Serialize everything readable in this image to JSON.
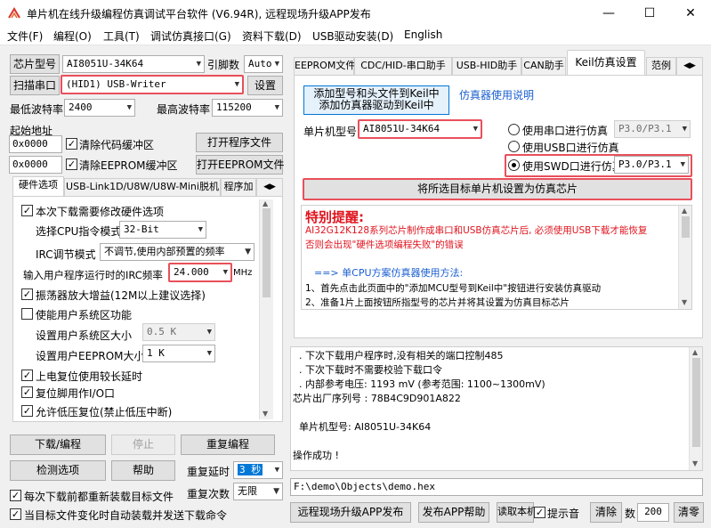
{
  "window": {
    "title": "单片机在线升级编程仿真调试平台软件 (V6.94R), 远程现场升级APP发布",
    "minimize": "—",
    "maximize": "☐",
    "close": "✕"
  },
  "menu": [
    "文件(F)",
    "编程(O)",
    "工具(T)",
    "调试仿真接口(G)",
    "资料下载(D)",
    "USB驱动安装(D)",
    "English"
  ],
  "left": {
    "chip_label": "芯片型号",
    "chip_value": "AI8051U-34K64",
    "pin_label": "引脚数",
    "pin_value": "Auto",
    "scan_button": "扫描串口",
    "port_value": "(HID1) USB-Writer",
    "settings_button": "设置",
    "min_baud_label": "最低波特率",
    "min_baud_value": "2400",
    "max_baud_label": "最高波特率",
    "max_baud_value": "115200",
    "start_addr_label": "起始地址",
    "addr1_value": "0x0000",
    "clear_code_label": "清除代码缓冲区",
    "open_prog_button": "打开程序文件",
    "addr2_value": "0x0000",
    "clear_eeprom_label": "清除EEPROM缓冲区",
    "open_eeprom_button": "打开EEPROM文件",
    "tabs": [
      "硬件选项",
      "USB-Link1D/U8W/U8W-Mini脱机",
      "程序加"
    ],
    "hw": {
      "need_modify": "本次下载需要修改硬件选项",
      "cpu_mode_label": "选择CPU指令模式",
      "cpu_mode_value": "32-Bit",
      "irc_mode_label": "IRC调节模式",
      "irc_mode_value": "不调节,使用内部预置的频率",
      "irc_freq_label": "输入用户程序运行时的IRC频率",
      "irc_freq_value": "24.000",
      "irc_unit": "MHz",
      "osc_gain": "振荡器放大增益(12M以上建议选择)",
      "enable_user_sys": "使能用户系统区功能",
      "user_sys_size_label": "设置用户系统区大小",
      "user_sys_size_value": "0.5 K",
      "eeprom_size_label": "设置用户EEPROM大小",
      "eeprom_size_value": "1   K",
      "power_delay": "上电复位使用较长延时",
      "reset_pin_io": "复位脚用作I/O口",
      "low_volt_reset": "允许低压复位(禁止低压中断)"
    },
    "download_button": "下载/编程",
    "stop_button": "停止",
    "reprogram_button": "重复编程",
    "check_button": "检测选项",
    "help_button": "帮助",
    "repeat_delay_label": "重复延时",
    "repeat_delay_value": "3 秒",
    "repeat_count_label": "重复次数",
    "repeat_count_value": "无限",
    "reload_label": "每次下载前都重新装载目标文件",
    "auto_load_label": "当目标文件变化时自动装载并发送下载命令"
  },
  "right": {
    "tabs": [
      "EEPROM文件",
      "CDC/HID-串口助手",
      "USB-HID助手",
      "CAN助手",
      "Keil仿真设置",
      "范例"
    ],
    "keil_button_line1": "添加型号和头文件到Keil中",
    "keil_button_line2": "添加仿真器驱动到Keil中",
    "emu_doc_link": "仿真器使用说明",
    "mcu_label": "单片机型号",
    "mcu_value": "AI8051U-34K64",
    "radio_serial": "使用串口进行仿真",
    "radio_serial_value": "P3.0/P3.1",
    "radio_usb": "使用USB口进行仿真",
    "radio_swd": "使用SWD口进行仿真",
    "radio_swd_value": "P3.0/P3.1",
    "set_target_button": "将所选目标单片机设置为仿真芯片",
    "notice_title": "特别提醒:",
    "notice_line1": "AI32G12K128系列芯片制作成串口和USB仿真芯片后, 必须使用USB下载才能恢复",
    "notice_line2": "否则会出现\"硬件选项编程失败\"的错误",
    "notice_line3": "==> 单CPU方案仿真器使用方法:",
    "notice_line4": "1、首先点击此页面中的\"添加MCU型号到Keil中\"按钮进行安装仿真驱动",
    "notice_line5": "2、准备1片上面按钮所指型号的芯片并将其设置为仿真目标芯片",
    "log": [
      "  . 下次下载用户程序时,没有相关的端口控制485",
      "  . 下次下载时不需要校验下载口令",
      "  . 内部参考电压: 1193 mV (参考范围: 1100~1300mV)",
      "芯片出厂序列号 : 78B4C9D901A822",
      "",
      "  单片机型号: AI8051U-34K64",
      "",
      "操作成功 !"
    ],
    "file_path": "F:\\demo\\Objects\\demo.hex",
    "publish_button": "远程现场升级APP发布",
    "publish_help_button": "发布APP帮助",
    "read_button": "读取本机",
    "beep_label": "提示音",
    "clear_button": "清除",
    "count_label": "数",
    "count_value": "200",
    "clear_zero_button": "清零"
  }
}
